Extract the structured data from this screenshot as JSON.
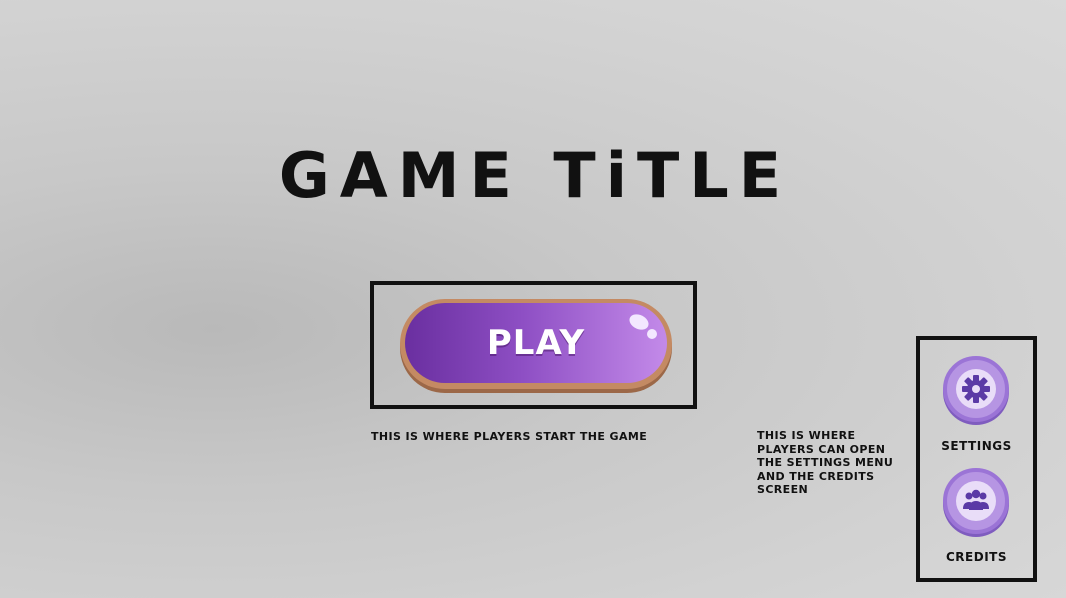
{
  "title": "GAME TiTLE",
  "play": {
    "label": "PLAY",
    "caption": "THiS iS WHERE PLAYERS START THE GAME"
  },
  "side_menu": {
    "caption": "THiS iS WHERE PLAYERS CAN OPEN THE SETTiNGS MENU AND THE CREDiTS SCREEN",
    "settings": {
      "label": "SETTiNGS",
      "icon": "gear-icon"
    },
    "credits": {
      "label": "CREDiTS",
      "icon": "people-icon"
    }
  },
  "colors": {
    "accent_dark": "#6a2fa0",
    "accent_light": "#c38ae9",
    "button_rim": "#c48a63",
    "icon_purple": "#5b3aa6"
  }
}
